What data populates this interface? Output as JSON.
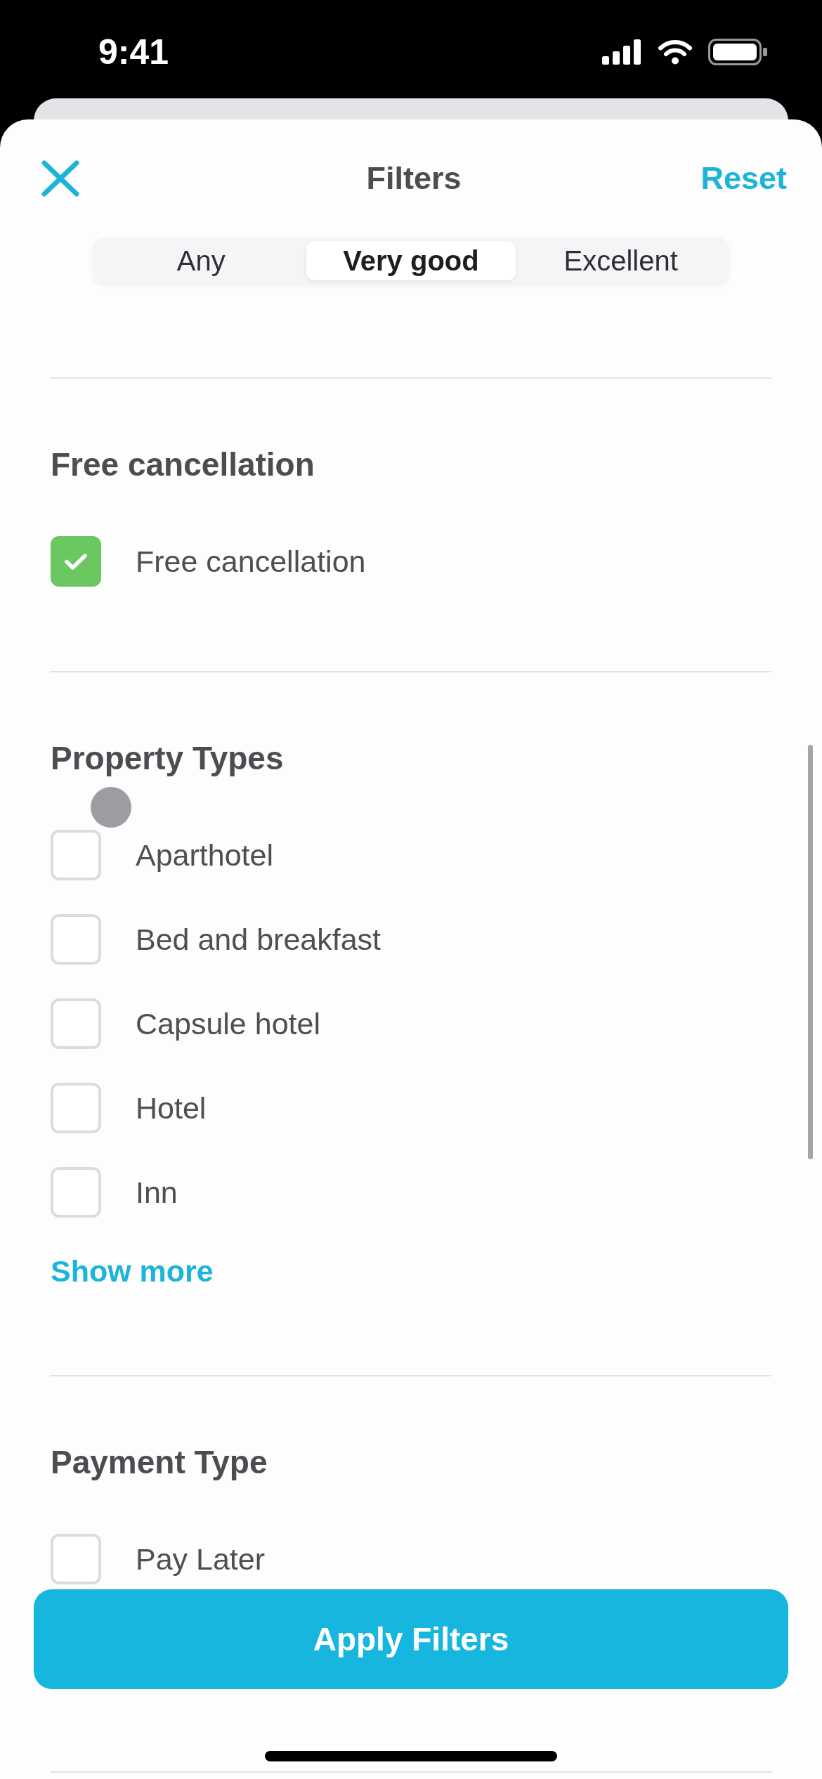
{
  "status_bar": {
    "time": "9:41"
  },
  "header": {
    "title": "Filters",
    "reset": "Reset"
  },
  "rating_segments": [
    {
      "label": "Any",
      "selected": false
    },
    {
      "label": "Very good",
      "selected": true
    },
    {
      "label": "Excellent",
      "selected": false
    }
  ],
  "sections": [
    {
      "title": "Free cancellation",
      "options": [
        {
          "label": "Free cancellation",
          "checked": true
        }
      ]
    },
    {
      "title": "Property Types",
      "options": [
        {
          "label": "Aparthotel",
          "checked": false
        },
        {
          "label": "Bed and breakfast",
          "checked": false
        },
        {
          "label": "Capsule hotel",
          "checked": false
        },
        {
          "label": "Hotel",
          "checked": false
        },
        {
          "label": "Inn",
          "checked": false
        }
      ],
      "show_more": "Show more"
    },
    {
      "title": "Payment Type",
      "options": [
        {
          "label": "Pay Later",
          "checked": false
        }
      ]
    }
  ],
  "apply_button": "Apply Filters"
}
